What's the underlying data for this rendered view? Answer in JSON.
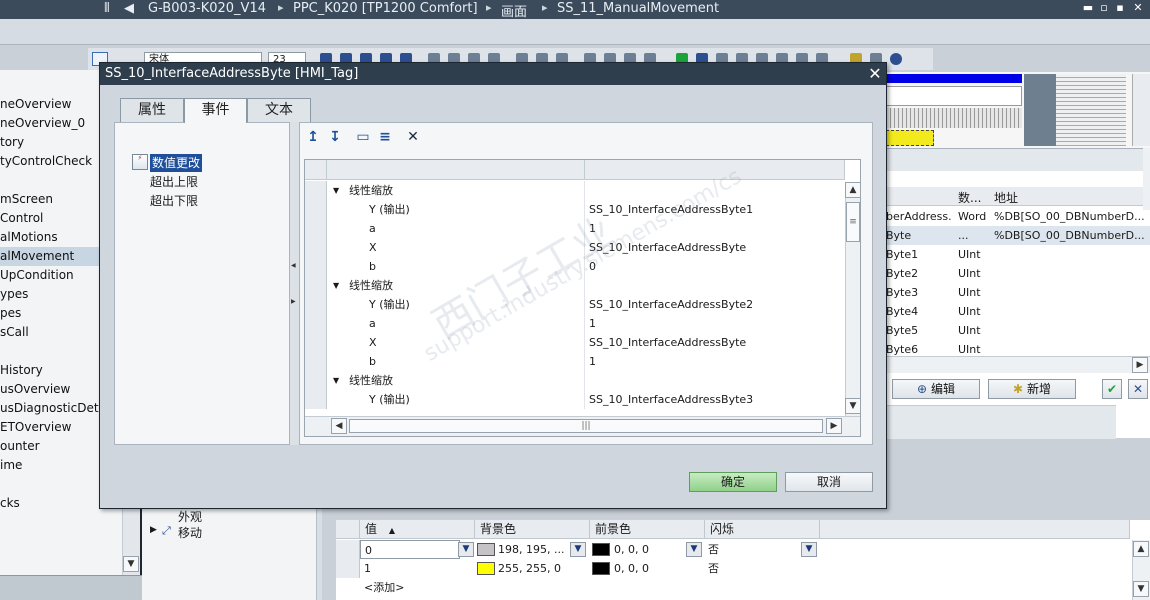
{
  "titlebar": {
    "crumbs": [
      "G-B003-K020_V14",
      "PPC_K020 [TP1200 Comfort]",
      "画面",
      "SS_11_ManualMovement"
    ],
    "separator": "▸",
    "back": "◀",
    "min": "▬",
    "restore": "▫",
    "max": "▪",
    "close": "✕"
  },
  "toolbar": {
    "font_field": "宋体",
    "size_field": "23"
  },
  "left_tree": {
    "items": [
      "neOverview",
      "neOverview_0",
      "tory",
      "tyControlCheck",
      "",
      "mScreen",
      "Control",
      "alMotions",
      "alMovement",
      "UpCondition",
      "ypes",
      "pes",
      "sCall",
      "",
      "History",
      "usOverview",
      "usDiagnosticDetai",
      "ETOverview",
      "ounter",
      "ime",
      "",
      "cks"
    ],
    "selected_index": 8
  },
  "tag_table": {
    "headers": [
      "数...",
      "地址"
    ],
    "rows": [
      {
        "name": "berAddress.",
        "type": "Word",
        "dots": "",
        "address": "%DB[SO_00_DBNumberD..."
      },
      {
        "name": "Byte",
        "type": "...",
        "dots": "...",
        "address": "%DB[SO_00_DBNumberD..."
      },
      {
        "name": "Byte1",
        "type": "UInt",
        "dots": "",
        "address": ""
      },
      {
        "name": "Byte2",
        "type": "UInt",
        "dots": "",
        "address": ""
      },
      {
        "name": "Byte3",
        "type": "UInt",
        "dots": "",
        "address": ""
      },
      {
        "name": "Byte4",
        "type": "UInt",
        "dots": "",
        "address": ""
      },
      {
        "name": "Byte5",
        "type": "UInt",
        "dots": "",
        "address": ""
      },
      {
        "name": "Byte6",
        "type": "UInt",
        "dots": "",
        "address": ""
      }
    ],
    "edit_label": "编辑",
    "add_label": "新增",
    "scroll_right": "▶",
    "scroll_down": "▼",
    "ok_check": "✔",
    "cancel_x": "✕"
  },
  "dialog": {
    "title": "SS_10_InterfaceAddressByte [HMI_Tag]",
    "close": "✕",
    "tabs": [
      "属性",
      "事件",
      "文本"
    ],
    "active_tab": 1,
    "events": [
      "数值更改",
      "超出上限",
      "超出下限"
    ],
    "toolbar": {
      "up": "↥",
      "down": "↧",
      "add": "▭",
      "list": "≡",
      "delete": "✕"
    },
    "grid_rows": [
      {
        "level": 0,
        "expander": "▼",
        "label": "线性缩放",
        "value": ""
      },
      {
        "level": 1,
        "expander": "",
        "label": "Y (输出)",
        "value": "SS_10_InterfaceAddressByte1"
      },
      {
        "level": 1,
        "expander": "",
        "label": "a",
        "value": "1"
      },
      {
        "level": 1,
        "expander": "",
        "label": "X",
        "value": "SS_10_InterfaceAddressByte"
      },
      {
        "level": 1,
        "expander": "",
        "label": "b",
        "value": "0"
      },
      {
        "level": 0,
        "expander": "▼",
        "label": "线性缩放",
        "value": ""
      },
      {
        "level": 1,
        "expander": "",
        "label": "Y (输出)",
        "value": "SS_10_InterfaceAddressByte2"
      },
      {
        "level": 1,
        "expander": "",
        "label": "a",
        "value": "1"
      },
      {
        "level": 1,
        "expander": "",
        "label": "X",
        "value": "SS_10_InterfaceAddressByte"
      },
      {
        "level": 1,
        "expander": "",
        "label": "b",
        "value": "1"
      },
      {
        "level": 0,
        "expander": "▼",
        "label": "线性缩放",
        "value": ""
      },
      {
        "level": 1,
        "expander": "",
        "label": "Y (输出)",
        "value": "SS_10_InterfaceAddressByte3"
      }
    ],
    "ok_label": "确定",
    "cancel_label": "取消",
    "scroll_up": "▲",
    "scroll_down": "▼",
    "scroll_left": "◀",
    "scroll_right": "▶",
    "thumb": "|||"
  },
  "bottom_tree": {
    "item1": "外观",
    "item2": "移动",
    "expander": "▶"
  },
  "bottom_grid": {
    "headers": [
      "值",
      "背景色",
      "前景色",
      "闪烁"
    ],
    "sort_indicator": "▲",
    "rows": [
      {
        "value": "0",
        "bg_color_text": "198, 195, ...",
        "bg_color": "#c6c3c6",
        "fg_color_text": "0, 0, 0",
        "fg_color": "#000000",
        "blink": "否"
      },
      {
        "value": "1",
        "bg_color_text": "255, 255, 0",
        "bg_color": "#ffff00",
        "fg_color_text": "0, 0, 0",
        "fg_color": "#000000",
        "blink": "否"
      }
    ],
    "add_row": "<添加>",
    "dropdown": "▼"
  },
  "watermark": {
    "line1": "西门子工业",
    "line2": "support.industry.siemens.com/cs"
  },
  "colors": {
    "accent": "#1f4f9a",
    "title_bg": "#2f3e4d",
    "ok_green": "#9fd79a"
  }
}
